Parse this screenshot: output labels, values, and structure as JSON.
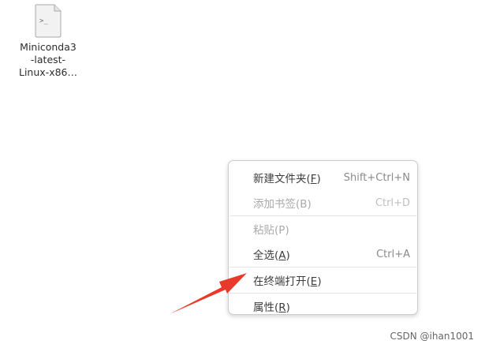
{
  "desktop": {
    "file": {
      "icon": "terminal-script-icon",
      "name_lines": [
        "Miniconda3",
        "-latest-",
        "Linux-x86…"
      ]
    }
  },
  "context_menu": {
    "items": [
      {
        "label": "新建文件夹",
        "mnemonic": "F",
        "accel": "Shift+Ctrl+N",
        "enabled": true
      },
      {
        "label": "添加书签",
        "mnemonic": "B",
        "accel": "Ctrl+D",
        "enabled": false
      },
      {
        "label": "粘贴",
        "mnemonic": "P",
        "accel": "",
        "enabled": false
      },
      {
        "label": "全选",
        "mnemonic": "A",
        "accel": "Ctrl+A",
        "enabled": true
      },
      {
        "label": "在终端打开",
        "mnemonic": "E",
        "accel": "",
        "enabled": true
      },
      {
        "label": "属性",
        "mnemonic": "R",
        "accel": "",
        "enabled": true
      }
    ]
  },
  "annotation": {
    "arrow_color": "#e8392a"
  },
  "watermark": "CSDN @ihan1001"
}
